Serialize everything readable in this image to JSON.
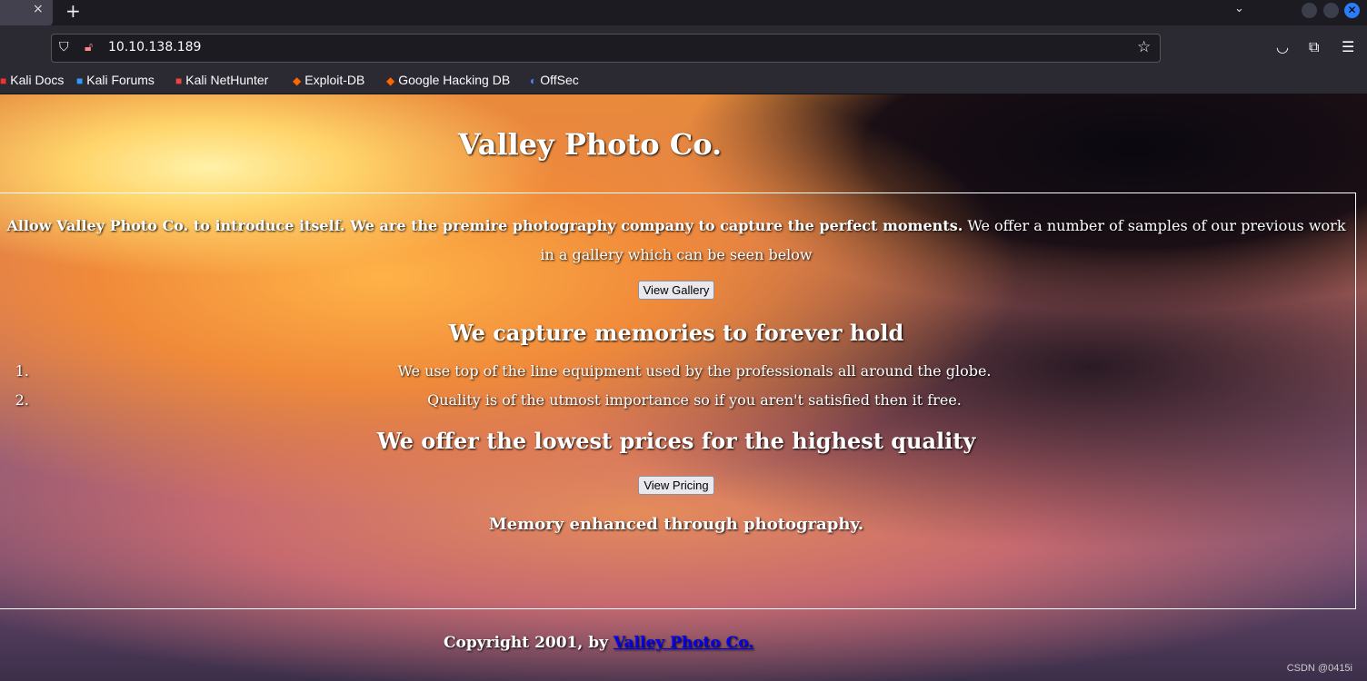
{
  "browser": {
    "tab_close": "×",
    "new_tab": "+",
    "url": "10.10.138.189",
    "bookmarks": [
      "Kali Docs",
      "Kali Forums",
      "Kali NetHunter",
      "Exploit-DB",
      "Google Hacking DB",
      "OffSec"
    ]
  },
  "page": {
    "title": "Valley Photo Co.",
    "intro_bold": "Allow Valley Photo Co. to introduce itself. We are the premire photography company to capture the perfect moments.",
    "intro_rest": " We offer a number of samples of our previous work in a gallery which can be seen below",
    "gallery_button": "View Gallery",
    "heading1": "We capture memories to forever hold",
    "list": [
      "We use top of the line equipment used by the professionals all around the globe.",
      "Quality is of the utmost importance so if you aren't satisfied then it free."
    ],
    "heading2": "We offer the lowest prices for the highest quality",
    "pricing_button": "View Pricing",
    "tagline": "Memory enhanced through photography.",
    "copyright": "Copyright 2001, by ",
    "copyright_link": "Valley Photo Co."
  },
  "watermark": "CSDN @0415i"
}
